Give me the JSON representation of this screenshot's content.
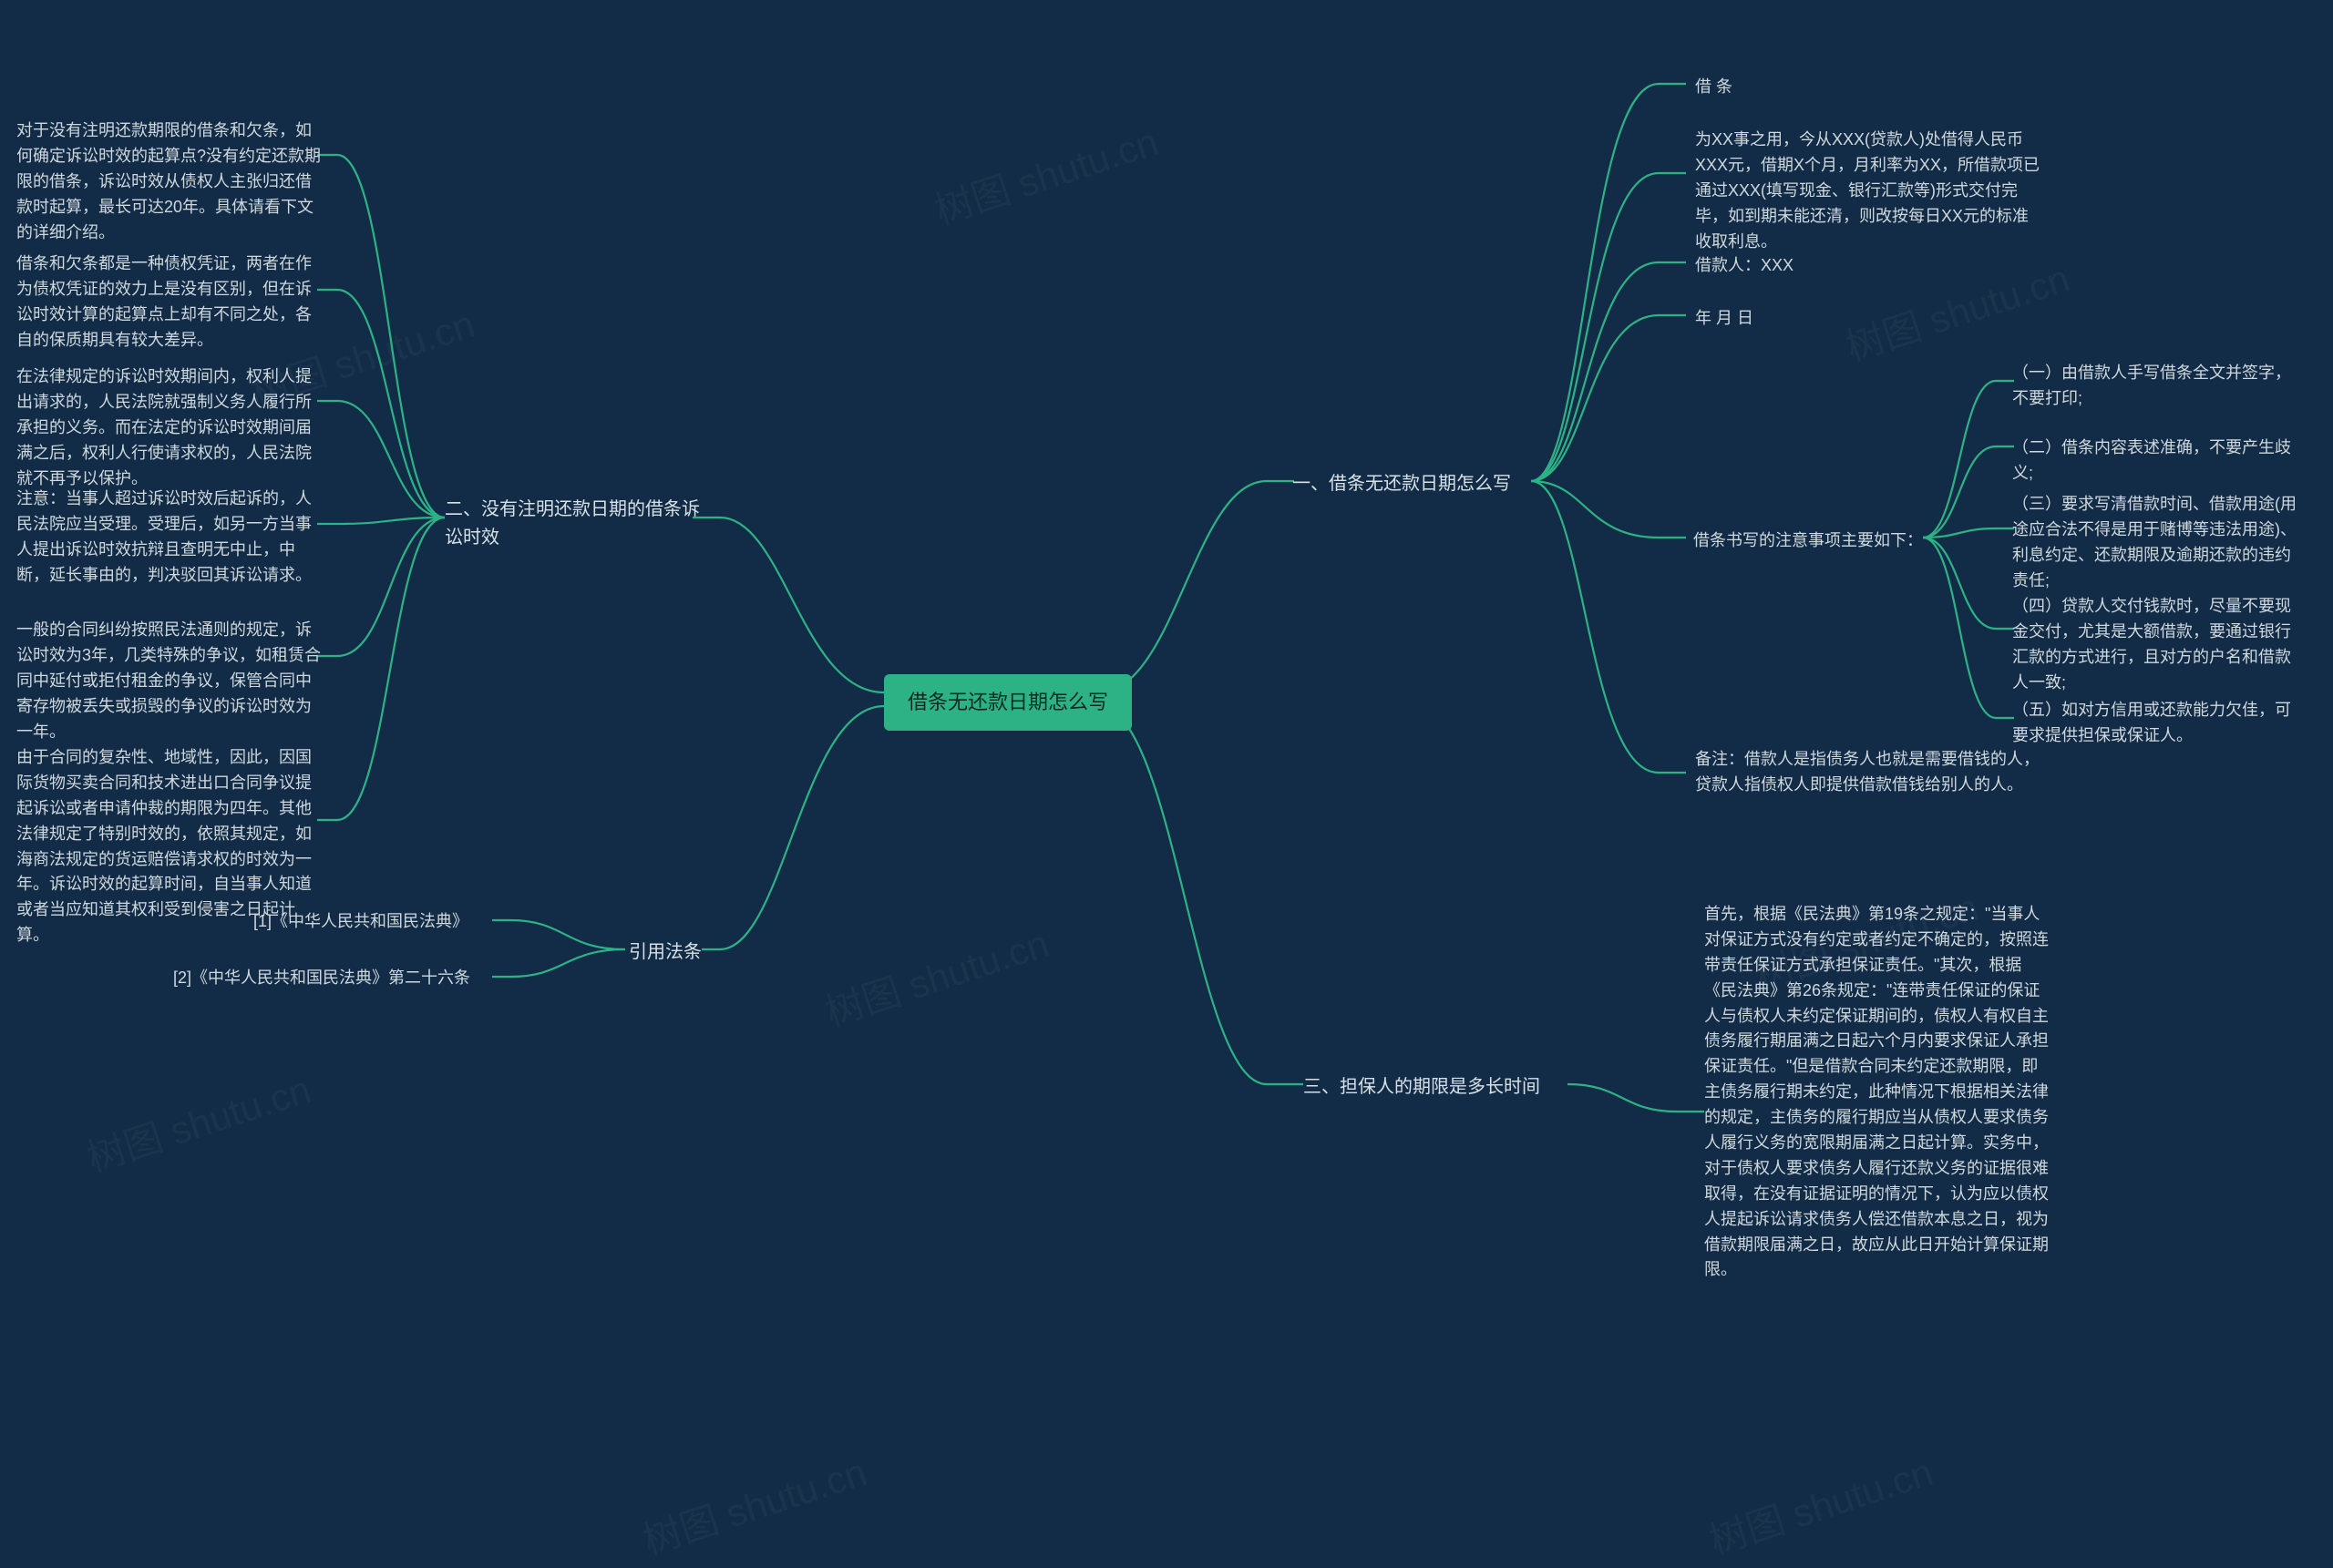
{
  "watermark": "树图 shutu.cn",
  "center": {
    "label": "借条无还款日期怎么写"
  },
  "right": {
    "sec1": {
      "title": "一、借条无还款日期怎么写",
      "i1": "借 条",
      "i2": "为XX事之用，今从XXX(贷款人)处借得人民币XXX元，借期X个月，月利率为XX，所借款项已通过XXX(填写现金、银行汇款等)形式交付完毕，如到期未能还清，则改按每日XX元的标准收取利息。",
      "i3": "借款人：XXX",
      "i4": "年 月 日",
      "sub_title": "借条书写的注意事项主要如下：",
      "s1": "（一）由借款人手写借条全文并签字，不要打印;",
      "s2": "（二）借条内容表述准确，不要产生歧义;",
      "s3": "（三）要求写清借款时间、借款用途(用途应合法不得是用于赌博等违法用途)、利息约定、还款期限及逾期还款的违约责任;",
      "s4": "（四）贷款人交付钱款时，尽量不要现金交付，尤其是大额借款，要通过银行汇款的方式进行，且对方的户名和借款人一致;",
      "s5": "（五）如对方信用或还款能力欠佳，可要求提供担保或保证人。",
      "note": "备注：借款人是指债务人也就是需要借钱的人，贷款人指债权人即提供借款借钱给别人的人。"
    },
    "sec3": {
      "title": "三、担保人的期限是多长时间",
      "body": "首先，根据《民法典》第19条之规定：\"当事人对保证方式没有约定或者约定不确定的，按照连带责任保证方式承担保证责任。\"其次，根据《民法典》第26条规定：\"连带责任保证的保证人与债权人未约定保证期间的，债权人有权自主债务履行期届满之日起六个月内要求保证人承担保证责任。\"但是借款合同未约定还款期限，即主债务履行期未约定，此种情况下根据相关法律的规定，主债务的履行期应当从债权人要求债务人履行义务的宽限期届满之日起计算。实务中，对于债权人要求债务人履行还款义务的证据很难取得，在没有证据证明的情况下，认为应以债权人提起诉讼请求债务人偿还借款本息之日，视为借款期限届满之日，故应从此日开始计算保证期限。"
    }
  },
  "left": {
    "sec2": {
      "title": "二、没有注明还款日期的借条诉讼时效",
      "i1": "对于没有注明还款期限的借条和欠条，如何确定诉讼时效的起算点?没有约定还款期限的借条，诉讼时效从债权人主张归还借款时起算，最长可达20年。具体请看下文的详细介绍。",
      "i2": "借条和欠条都是一种债权凭证，两者在作为债权凭证的效力上是没有区别，但在诉讼时效计算的起算点上却有不同之处，各自的保质期具有较大差异。",
      "i3": "在法律规定的诉讼时效期间内，权利人提出请求的，人民法院就强制义务人履行所承担的义务。而在法定的诉讼时效期间届满之后，权利人行使请求权的，人民法院就不再予以保护。",
      "i4": "注意：当事人超过诉讼时效后起诉的，人民法院应当受理。受理后，如另一方当事人提出诉讼时效抗辩且查明无中止，中断，延长事由的，判决驳回其诉讼请求。",
      "i5": "一般的合同纠纷按照民法通则的规定，诉讼时效为3年，几类特殊的争议，如租赁合同中延付或拒付租金的争议，保管合同中寄存物被丢失或损毁的争议的诉讼时效为一年。",
      "i6": "由于合同的复杂性、地域性，因此，因国际货物买卖合同和技术进出口合同争议提起诉讼或者申请仲裁的期限为四年。其他法律规定了特别时效的，依照其规定，如海商法规定的货运赔偿请求权的时效为一年。诉讼时效的起算时间，自当事人知道或者当应知道其权利受到侵害之日起计算。"
    },
    "law": {
      "title": "引用法条",
      "i1": "[1]《中华人民共和国民法典》",
      "i2": "[2]《中华人民共和国民法典》第二十六条"
    }
  }
}
